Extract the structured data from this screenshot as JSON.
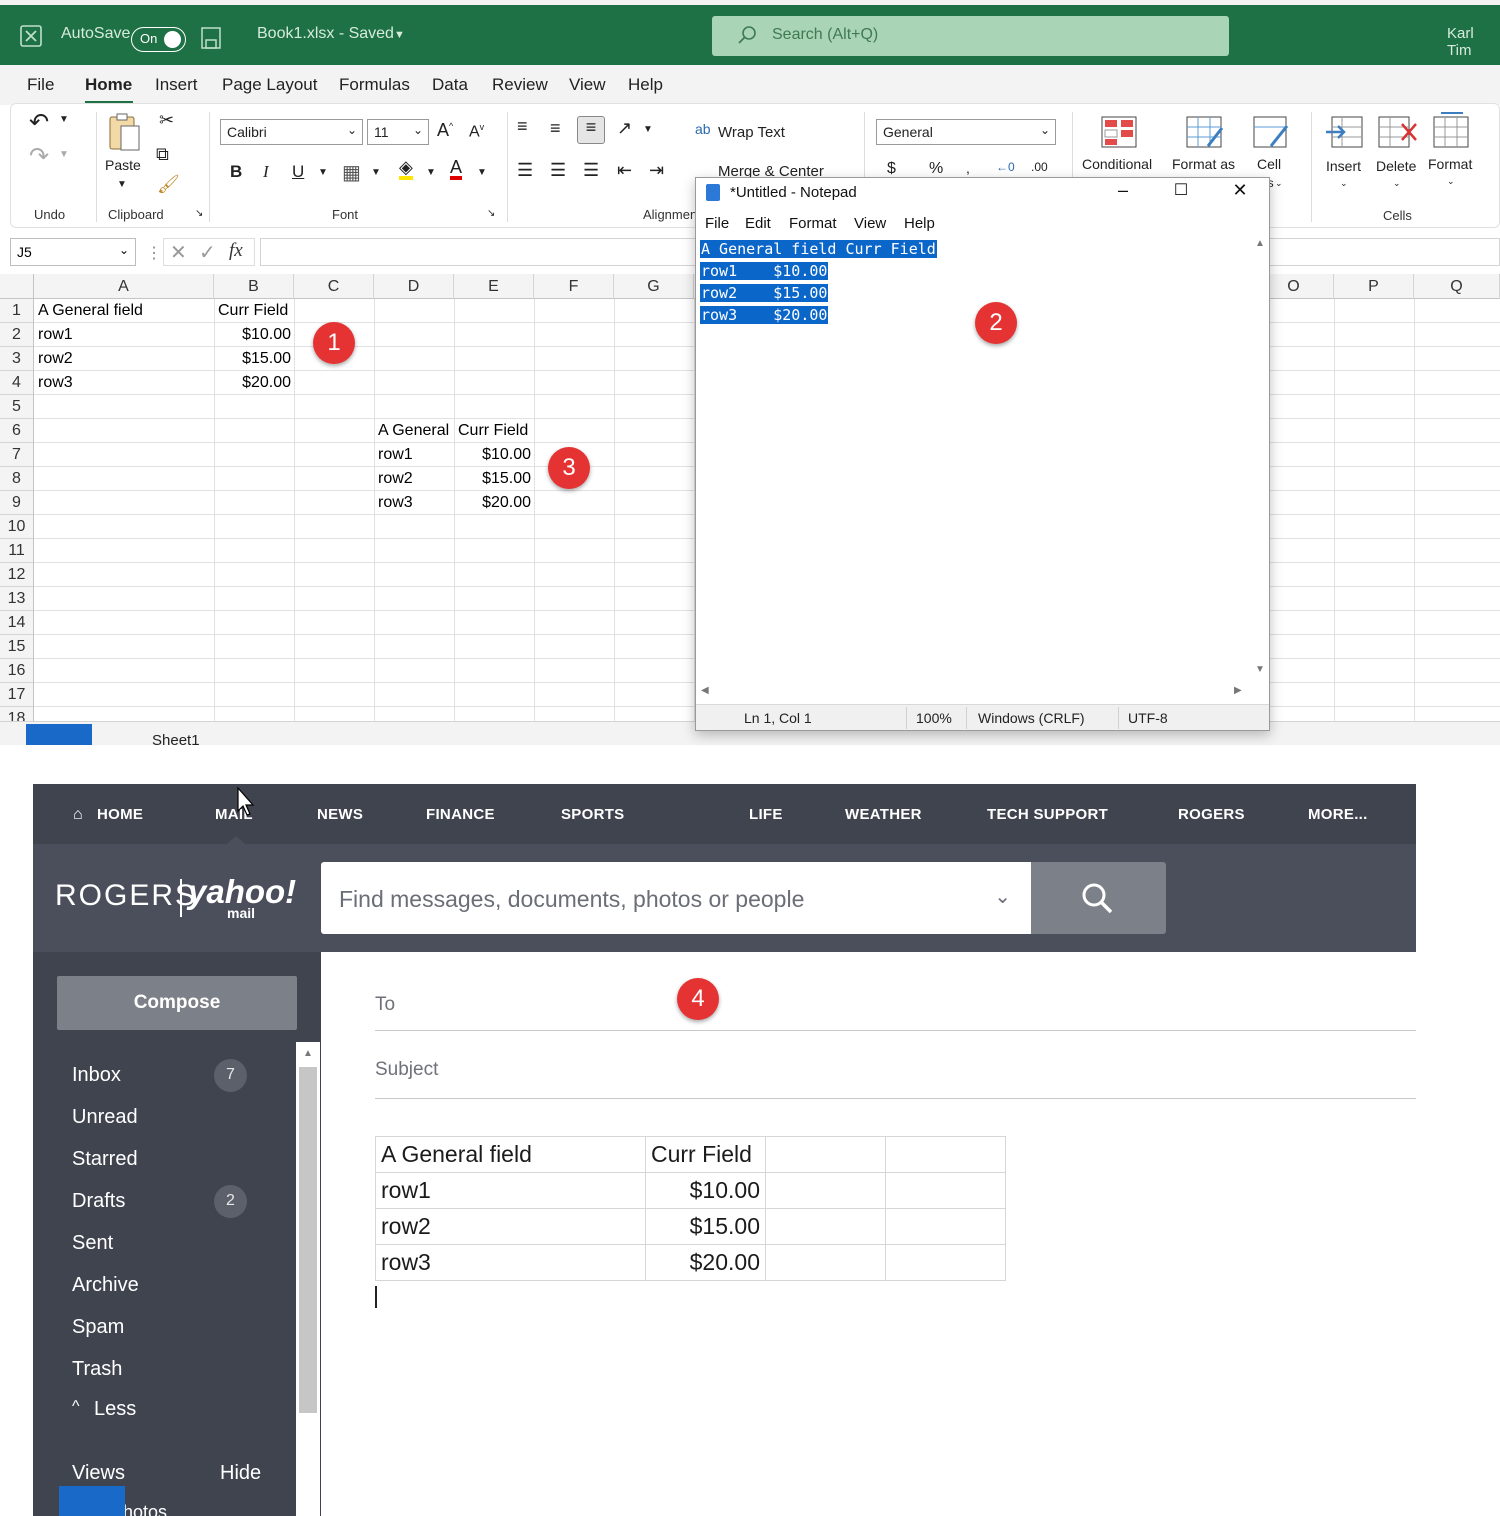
{
  "excel": {
    "autosave_label": "AutoSave",
    "autosave_state": "On",
    "file_title": "Book1.xlsx - Saved",
    "search_placeholder": "Search (Alt+Q)",
    "user": "Karl Tim",
    "menu": [
      "File",
      "Home",
      "Insert",
      "Page Layout",
      "Formulas",
      "Data",
      "Review",
      "View",
      "Help"
    ],
    "ribbon": {
      "undo_group": "Undo",
      "clipboard_group": "Clipboard",
      "paste_label": "Paste",
      "font_group": "Font",
      "font_name": "Calibri",
      "font_size": "11",
      "bold": "B",
      "italic": "I",
      "underline": "U",
      "alignment_group": "Alignmen",
      "wrap_text": "Wrap Text",
      "merge_center": "Merge & Center",
      "number_format": "General",
      "conditional": "Conditional",
      "format_as": "Format as",
      "cell": "Cell",
      "styles_frag": "es",
      "insert": "Insert",
      "delete": "Delete",
      "format": "Format",
      "cells_group": "Cells"
    },
    "name_box": "J5",
    "columns": [
      "A",
      "B",
      "C",
      "D",
      "E",
      "F",
      "G",
      "O",
      "P",
      "Q"
    ],
    "rows": [
      "1",
      "2",
      "3",
      "4",
      "5",
      "6",
      "7",
      "8",
      "9",
      "10",
      "11",
      "12",
      "13",
      "14",
      "15",
      "16",
      "17",
      "18"
    ],
    "table1": {
      "headers": [
        "A General field",
        "Curr Field"
      ],
      "rows": [
        [
          "row1",
          "$10.00"
        ],
        [
          "row2",
          "$15.00"
        ],
        [
          "row3",
          "$20.00"
        ]
      ]
    },
    "table2": {
      "headers": [
        "A General",
        "Curr Field"
      ],
      "rows": [
        [
          "row1",
          "$10.00"
        ],
        [
          "row2",
          "$15.00"
        ],
        [
          "row3",
          "$20.00"
        ]
      ]
    },
    "sheet_tab": "Sheet1"
  },
  "notepad": {
    "title": "*Untitled - Notepad",
    "menu": [
      "File",
      "Edit",
      "Format",
      "View",
      "Help"
    ],
    "lines": [
      "A General field Curr Field",
      "row1    $10.00",
      "row2    $15.00",
      "row3    $20.00"
    ],
    "status": {
      "position": "Ln 1, Col 1",
      "zoom": "100%",
      "eol": "Windows (CRLF)",
      "encoding": "UTF-8"
    }
  },
  "badges": [
    "1",
    "2",
    "3",
    "4"
  ],
  "mail": {
    "nav": [
      "HOME",
      "MAIL",
      "NEWS",
      "FINANCE",
      "SPORTS",
      "LIFE",
      "WEATHER",
      "TECH SUPPORT",
      "ROGERS",
      "MORE..."
    ],
    "logo_rogers": "ROGERS",
    "logo_yahoo": "yahoo!",
    "logo_mail": "mail",
    "search_placeholder": "Find messages, documents, photos or people",
    "compose": "Compose",
    "folders": [
      {
        "label": "Inbox",
        "count": "7"
      },
      {
        "label": "Unread",
        "count": ""
      },
      {
        "label": "Starred",
        "count": ""
      },
      {
        "label": "Drafts",
        "count": "2"
      },
      {
        "label": "Sent",
        "count": ""
      },
      {
        "label": "Archive",
        "count": ""
      },
      {
        "label": "Spam",
        "count": ""
      },
      {
        "label": "Trash",
        "count": ""
      }
    ],
    "less": "Less",
    "views": "Views",
    "hide": "Hide",
    "photos_frag": "hotos",
    "to_label": "To",
    "subject_label": "Subject",
    "table": {
      "headers": [
        "A General field",
        "Curr Field",
        "",
        ""
      ],
      "rows": [
        [
          "row1",
          "$10.00",
          "",
          ""
        ],
        [
          "row2",
          "$15.00",
          "",
          ""
        ],
        [
          "row3",
          "$20.00",
          "",
          ""
        ]
      ]
    }
  },
  "colors": {
    "excel_green": "#1e7145",
    "badge_red": "#e53232",
    "yahoo_dark": "#3f444f",
    "selection_blue": "#0b66c9"
  }
}
